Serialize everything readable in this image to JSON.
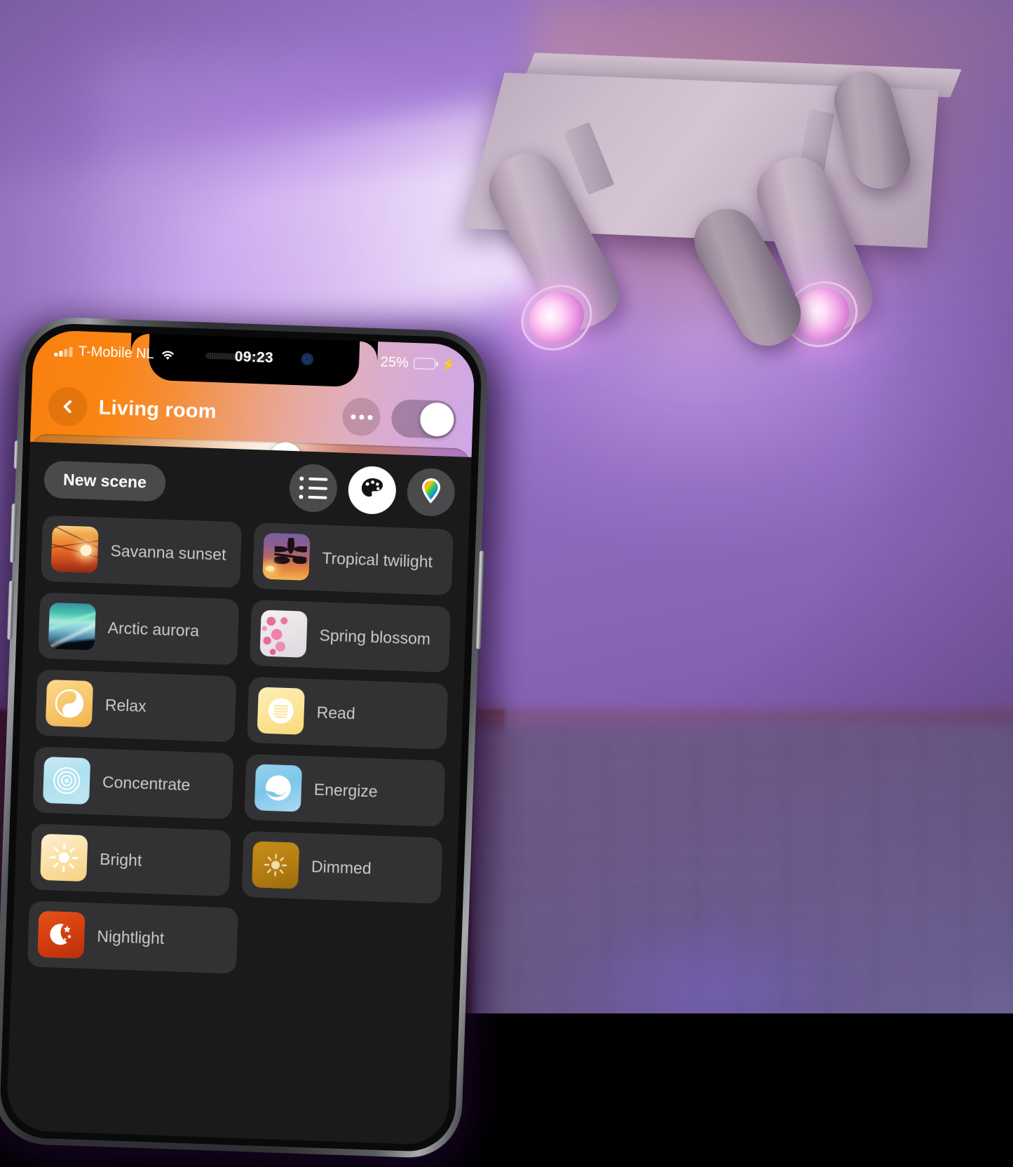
{
  "statusbar": {
    "carrier": "T-Mobile NL",
    "time": "09:23",
    "battery_percent": "25%",
    "signal_icon": "signal-bars-icon",
    "wifi_icon": "wifi-icon",
    "battery_icon": "battery-icon",
    "charging_icon": "lightning-bolt-icon",
    "battery_fill_color": "#3ddc5a"
  },
  "header": {
    "back_icon": "chevron-left-icon",
    "title": "Living room",
    "more_icon": "ellipsis-icon",
    "power_toggle": "on",
    "brightness_value": 58,
    "accent_start": "#f98010",
    "accent_end": "#cfa7e6"
  },
  "toolbar": {
    "new_scene_label": "New scene",
    "tabs": [
      {
        "id": "list",
        "icon": "list-bullets-icon",
        "active": false
      },
      {
        "id": "scenes",
        "icon": "paint-palette-icon",
        "active": true
      },
      {
        "id": "colors",
        "icon": "color-picker-pin-icon",
        "active": false
      }
    ]
  },
  "scenes": [
    [
      {
        "label": "Savanna sunset",
        "thumb": "savanna-sunset-photo",
        "art": "t-savanna",
        "glyph": ""
      },
      {
        "label": "Tropical twilight",
        "thumb": "tropical-twilight-photo",
        "art": "t-tropical",
        "glyph": ""
      }
    ],
    [
      {
        "label": "Arctic aurora",
        "thumb": "arctic-aurora-photo",
        "art": "t-aurora",
        "glyph": ""
      },
      {
        "label": "Spring blossom",
        "thumb": "spring-blossom-photo",
        "art": "t-blossom",
        "glyph": ""
      }
    ],
    [
      {
        "label": "Relax",
        "thumb": "relax-icon",
        "art": "t-relax",
        "glyph": "yin-circle-icon"
      },
      {
        "label": "Read",
        "thumb": "read-icon",
        "art": "t-read",
        "glyph": "lines-circle-icon"
      }
    ],
    [
      {
        "label": "Concentrate",
        "thumb": "concentrate-icon",
        "art": "t-conc",
        "glyph": "concentric-rings-icon"
      },
      {
        "label": "Energize",
        "thumb": "energize-icon",
        "art": "t-energ",
        "glyph": "bolt-circle-icon"
      }
    ],
    [
      {
        "label": "Bright",
        "thumb": "bright-icon",
        "art": "t-bright",
        "glyph": "sun-icon"
      },
      {
        "label": "Dimmed",
        "thumb": "dimmed-icon",
        "art": "t-dim",
        "glyph": "sun-dim-icon"
      }
    ],
    [
      {
        "label": "Nightlight",
        "thumb": "nightlight-icon",
        "art": "t-night",
        "glyph": "moon-stars-icon"
      }
    ]
  ]
}
